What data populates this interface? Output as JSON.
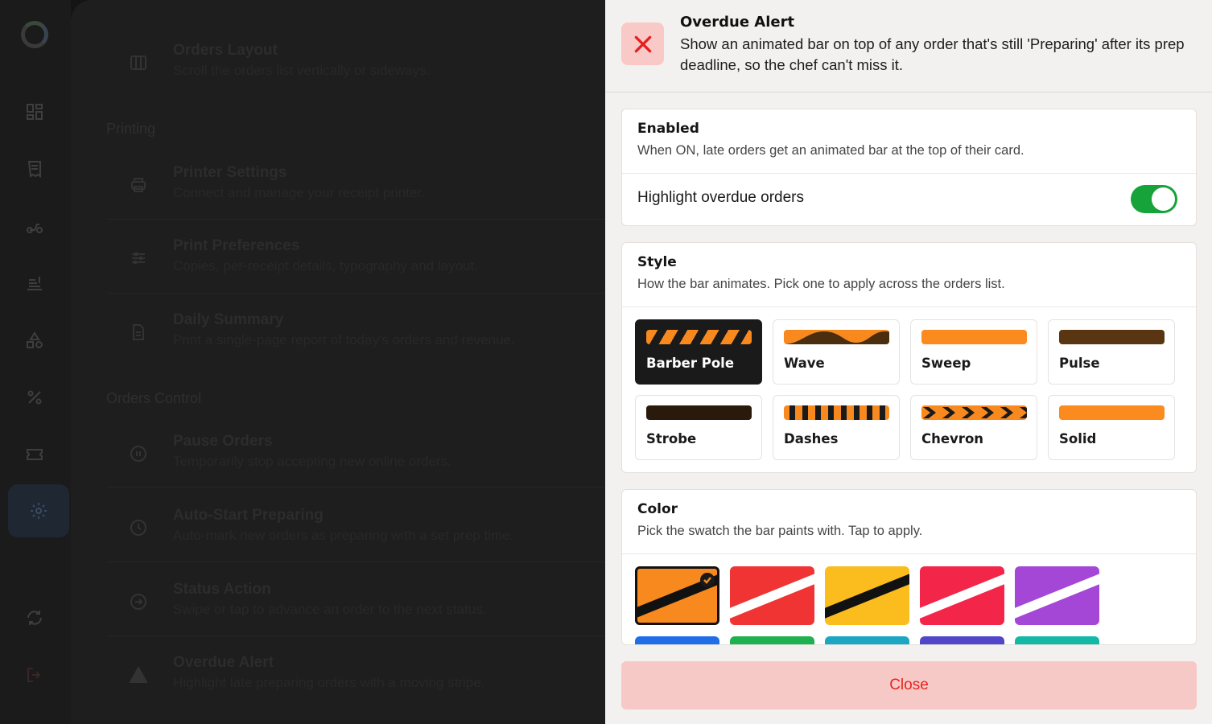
{
  "background": {
    "sections": {
      "printing": "Printing",
      "orders_control": "Orders Control"
    },
    "rows": [
      {
        "title": "Orders Layout",
        "desc": "Scroll the orders list vertically or sideways.",
        "icon": "columns-icon"
      },
      {
        "title": "Printer Settings",
        "desc": "Connect and manage your receipt printer.",
        "icon": "printer-icon"
      },
      {
        "title": "Print Preferences",
        "desc": "Copies, per-receipt details, typography and layout.",
        "icon": "sliders-icon"
      },
      {
        "title": "Daily Summary",
        "desc": "Print a single-page report of today's orders and revenue.",
        "icon": "document-icon"
      },
      {
        "title": "Pause Orders",
        "desc": "Temporarily stop accepting new online orders.",
        "icon": "pause-icon"
      },
      {
        "title": "Auto-Start Preparing",
        "desc": "Auto-mark new orders as preparing with a set prep time.",
        "icon": "clock-icon"
      },
      {
        "title": "Status Action",
        "desc": "Swipe or tap to advance an order to the next status.",
        "icon": "arrow-circle-icon"
      },
      {
        "title": "Overdue Alert",
        "desc": "Highlight late preparing orders with a moving stripe.",
        "icon": "warning-icon"
      }
    ]
  },
  "sheet": {
    "title": "Overdue Alert",
    "subtitle": "Show an animated bar on top of any order that's still 'Preparing' after its prep deadline, so the chef can't miss it.",
    "enabled": {
      "title": "Enabled",
      "desc": "When ON, late orders get an animated bar at the top of their card.",
      "toggle_label": "Highlight overdue orders",
      "toggle_on": true
    },
    "style": {
      "title": "Style",
      "desc": "How the bar animates. Pick one to apply across the orders list.",
      "options": [
        "Barber Pole",
        "Wave",
        "Sweep",
        "Pulse",
        "Strobe",
        "Dashes",
        "Chevron",
        "Solid"
      ],
      "selected": "Barber Pole"
    },
    "color": {
      "title": "Color",
      "desc": "Pick the swatch the bar paints with. Tap to apply.",
      "swatches": [
        "#f7891f",
        "#f03434",
        "#fbbd1e",
        "#f3264a",
        "#a447d6"
      ],
      "next_row": [
        "#1f6ee8",
        "#1fb150",
        "#1ba6c4",
        "#5145c9",
        "#14b8a6"
      ],
      "selected": "#f7891f"
    },
    "close_label": "Close"
  },
  "colors": {
    "accent_orange": "#f7891f",
    "toggle_green": "#16a33a",
    "close_red": "#e3241f"
  }
}
